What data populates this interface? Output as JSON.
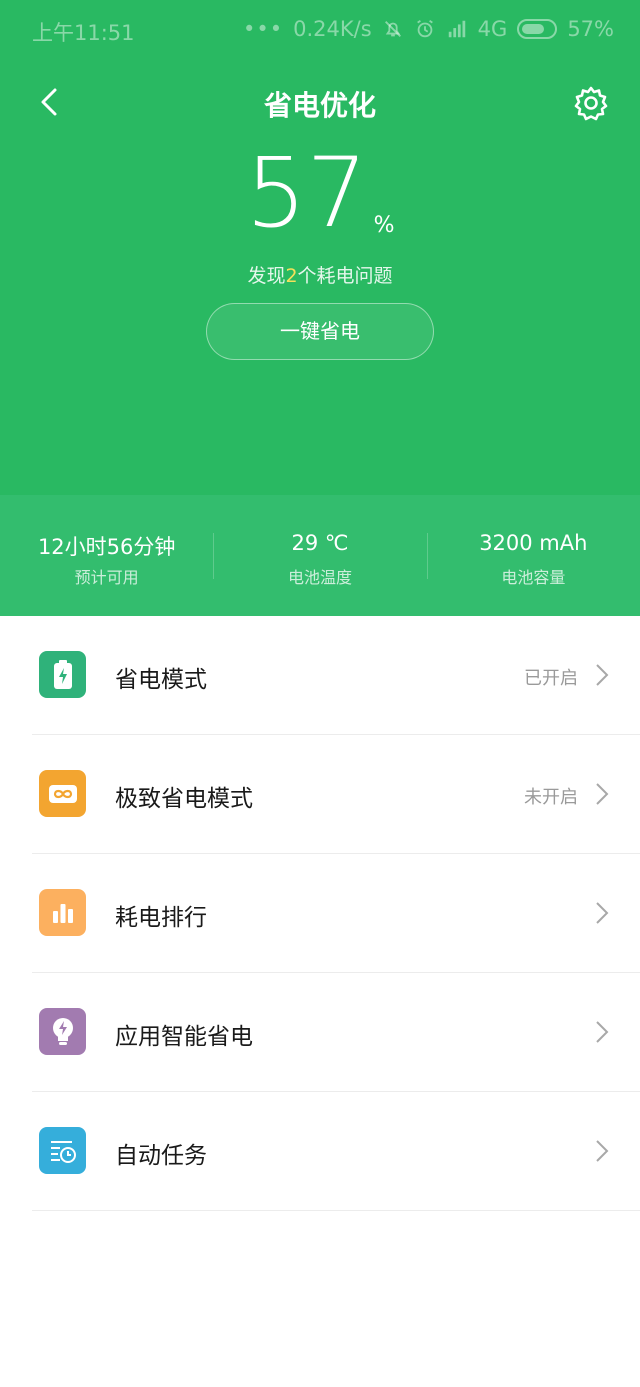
{
  "status_bar": {
    "time": "上午11:51",
    "dots": "•••",
    "network_speed": "0.24K/s",
    "network_type": "4G",
    "battery_percent": "57%"
  },
  "header": {
    "title": "省电优化"
  },
  "battery": {
    "value": "57",
    "unit": "%",
    "issues_prefix": "发现",
    "issues_count": "2",
    "issues_suffix": "个耗电问题",
    "optimize_label": "一键省电"
  },
  "stats": [
    {
      "value": "12小时56分钟",
      "label": "预计可用"
    },
    {
      "value": "29 ℃",
      "label": "电池温度"
    },
    {
      "value": "3200 mAh",
      "label": "电池容量"
    }
  ],
  "menu": [
    {
      "label": "省电模式",
      "status": "已开启",
      "icon": "battery-bolt-icon",
      "color": "#2fb27a"
    },
    {
      "label": "极致省电模式",
      "status": "未开启",
      "icon": "infinity-battery-icon",
      "color": "#f3a530"
    },
    {
      "label": "耗电排行",
      "status": "",
      "icon": "bar-chart-icon",
      "color": "#fcb05f"
    },
    {
      "label": "应用智能省电",
      "status": "",
      "icon": "lightbulb-bolt-icon",
      "color": "#a27bb0"
    },
    {
      "label": "自动任务",
      "status": "",
      "icon": "task-clock-icon",
      "color": "#35aedb"
    }
  ],
  "colors": {
    "hero": "#29b962",
    "stats_band": "#33bd6e",
    "highlight": "#f4e15a"
  }
}
